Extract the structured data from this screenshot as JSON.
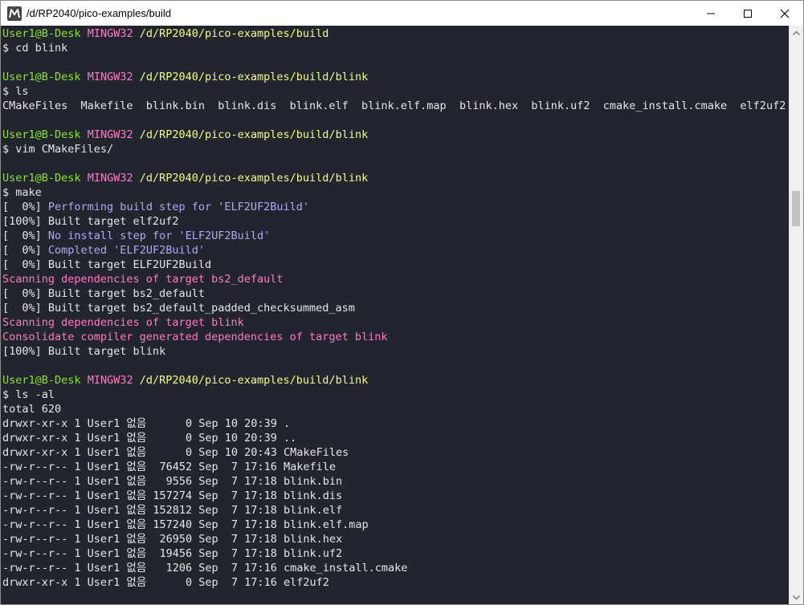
{
  "window": {
    "title": "/d/RP2040/pico-examples/build"
  },
  "lines": [
    {
      "segments": [
        {
          "t": "User1@B-Desk",
          "c": "green"
        },
        {
          "t": " ",
          "c": ""
        },
        {
          "t": "MINGW32",
          "c": "magenta"
        },
        {
          "t": " ",
          "c": ""
        },
        {
          "t": "/d/RP2040/pico-examples/build",
          "c": "yellow"
        }
      ]
    },
    {
      "segments": [
        {
          "t": "$ cd blink",
          "c": ""
        }
      ]
    },
    {
      "segments": []
    },
    {
      "segments": [
        {
          "t": "User1@B-Desk",
          "c": "green"
        },
        {
          "t": " ",
          "c": ""
        },
        {
          "t": "MINGW32",
          "c": "magenta"
        },
        {
          "t": " ",
          "c": ""
        },
        {
          "t": "/d/RP2040/pico-examples/build/blink",
          "c": "yellow"
        }
      ]
    },
    {
      "segments": [
        {
          "t": "$ ls",
          "c": ""
        }
      ]
    },
    {
      "segments": [
        {
          "t": "CMakeFiles  Makefile  blink.bin  blink.dis  blink.elf  blink.elf.map  blink.hex  blink.uf2  cmake_install.cmake  elf2uf2",
          "c": ""
        }
      ]
    },
    {
      "segments": []
    },
    {
      "segments": [
        {
          "t": "User1@B-Desk",
          "c": "green"
        },
        {
          "t": " ",
          "c": ""
        },
        {
          "t": "MINGW32",
          "c": "magenta"
        },
        {
          "t": " ",
          "c": ""
        },
        {
          "t": "/d/RP2040/pico-examples/build/blink",
          "c": "yellow"
        }
      ]
    },
    {
      "segments": [
        {
          "t": "$ vim CMakeFiles/",
          "c": ""
        }
      ]
    },
    {
      "segments": []
    },
    {
      "segments": [
        {
          "t": "User1@B-Desk",
          "c": "green"
        },
        {
          "t": " ",
          "c": ""
        },
        {
          "t": "MINGW32",
          "c": "magenta"
        },
        {
          "t": " ",
          "c": ""
        },
        {
          "t": "/d/RP2040/pico-examples/build/blink",
          "c": "yellow"
        }
      ]
    },
    {
      "segments": [
        {
          "t": "$ make",
          "c": ""
        }
      ]
    },
    {
      "segments": [
        {
          "t": "[  0%] ",
          "c": ""
        },
        {
          "t": "Performing build step for 'ELF2UF2Build'",
          "c": "purple"
        }
      ]
    },
    {
      "segments": [
        {
          "t": "[100%] Built target elf2uf2",
          "c": ""
        }
      ]
    },
    {
      "segments": [
        {
          "t": "[  0%] ",
          "c": ""
        },
        {
          "t": "No install step for 'ELF2UF2Build'",
          "c": "purple"
        }
      ]
    },
    {
      "segments": [
        {
          "t": "[  0%] ",
          "c": ""
        },
        {
          "t": "Completed 'ELF2UF2Build'",
          "c": "purple"
        }
      ]
    },
    {
      "segments": [
        {
          "t": "[  0%] Built target ELF2UF2Build",
          "c": ""
        }
      ]
    },
    {
      "segments": [
        {
          "t": "Scanning dependencies of target bs2_default",
          "c": "pink"
        }
      ]
    },
    {
      "segments": [
        {
          "t": "[  0%] Built target bs2_default",
          "c": ""
        }
      ]
    },
    {
      "segments": [
        {
          "t": "[  0%] Built target bs2_default_padded_checksummed_asm",
          "c": ""
        }
      ]
    },
    {
      "segments": [
        {
          "t": "Scanning dependencies of target blink",
          "c": "pink"
        }
      ]
    },
    {
      "segments": [
        {
          "t": "Consolidate compiler generated dependencies of target blink",
          "c": "pink"
        }
      ]
    },
    {
      "segments": [
        {
          "t": "[100%] Built target blink",
          "c": ""
        }
      ]
    },
    {
      "segments": []
    },
    {
      "segments": [
        {
          "t": "User1@B-Desk",
          "c": "green"
        },
        {
          "t": " ",
          "c": ""
        },
        {
          "t": "MINGW32",
          "c": "magenta"
        },
        {
          "t": " ",
          "c": ""
        },
        {
          "t": "/d/RP2040/pico-examples/build/blink",
          "c": "yellow"
        }
      ]
    },
    {
      "segments": [
        {
          "t": "$ ls -al",
          "c": ""
        }
      ]
    },
    {
      "segments": [
        {
          "t": "total 620",
          "c": ""
        }
      ]
    },
    {
      "segments": [
        {
          "t": "drwxr-xr-x 1 User1 없음      0 Sep 10 20:39 .",
          "c": ""
        }
      ]
    },
    {
      "segments": [
        {
          "t": "drwxr-xr-x 1 User1 없음      0 Sep 10 20:39 ..",
          "c": ""
        }
      ]
    },
    {
      "segments": [
        {
          "t": "drwxr-xr-x 1 User1 없음      0 Sep 10 20:43 CMakeFiles",
          "c": ""
        }
      ]
    },
    {
      "segments": [
        {
          "t": "-rw-r--r-- 1 User1 없음  76452 Sep  7 17:16 Makefile",
          "c": ""
        }
      ]
    },
    {
      "segments": [
        {
          "t": "-rw-r--r-- 1 User1 없음   9556 Sep  7 17:18 blink.bin",
          "c": ""
        }
      ]
    },
    {
      "segments": [
        {
          "t": "-rw-r--r-- 1 User1 없음 157274 Sep  7 17:18 blink.dis",
          "c": ""
        }
      ]
    },
    {
      "segments": [
        {
          "t": "-rw-r--r-- 1 User1 없음 152812 Sep  7 17:18 blink.elf",
          "c": ""
        }
      ]
    },
    {
      "segments": [
        {
          "t": "-rw-r--r-- 1 User1 없음 157240 Sep  7 17:18 blink.elf.map",
          "c": ""
        }
      ]
    },
    {
      "segments": [
        {
          "t": "-rw-r--r-- 1 User1 없음  26950 Sep  7 17:18 blink.hex",
          "c": ""
        }
      ]
    },
    {
      "segments": [
        {
          "t": "-rw-r--r-- 1 User1 없음  19456 Sep  7 17:18 blink.uf2",
          "c": ""
        }
      ]
    },
    {
      "segments": [
        {
          "t": "-rw-r--r-- 1 User1 없음   1206 Sep  7 17:16 cmake_install.cmake",
          "c": ""
        }
      ]
    },
    {
      "segments": [
        {
          "t": "drwxr-xr-x 1 User1 없음      0 Sep  7 17:16 elf2uf2",
          "c": ""
        }
      ]
    }
  ]
}
